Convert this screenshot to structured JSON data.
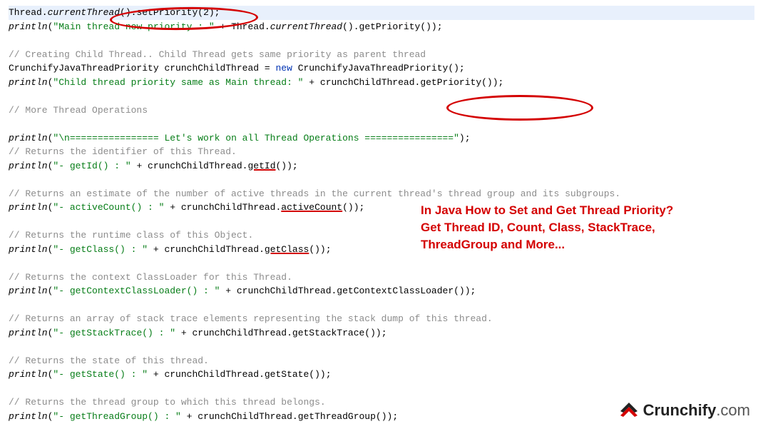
{
  "code": {
    "l1_a": "Thread.",
    "l1_b": "currentThread",
    "l1_c": "().setPriority(",
    "l1_d": "2",
    "l1_e": ");",
    "l2_a": "println",
    "l2_b": "(",
    "l2_c": "\"Main thread new priority : \"",
    "l2_d": " + Thread.",
    "l2_e": "currentThread",
    "l2_f": "().getPriority());",
    "l3": "",
    "l4": "// Creating Child Thread.. Child Thread gets same priority as parent thread",
    "l5_a": "CrunchifyJavaThreadPriority ",
    "l5_b": "crunchChildThread",
    "l5_c": " = ",
    "l5_d": "new ",
    "l5_e": "CrunchifyJavaThreadPriority();",
    "l6_a": "println",
    "l6_b": "(",
    "l6_c": "\"Child thread priority same as Main thread: \"",
    "l6_d": " + ",
    "l6_e": "crunchChildThread",
    "l6_f": ".getPriority());",
    "l7": "",
    "l8": "// More Thread Operations",
    "l9": "",
    "l10_a": "println",
    "l10_b": "(",
    "l10_c": "\"\\n================ Let's work on all Thread Operations ================\"",
    "l10_d": ");",
    "l11": "// Returns the identifier of this Thread.",
    "l12_a": "println",
    "l12_b": "(",
    "l12_c": "\"- getId() : \"",
    "l12_d": " + ",
    "l12_e": "crunchChildThread",
    "l12_f": ".",
    "l12_g": "getId",
    "l12_h": "());",
    "l13": "",
    "l14": "// Returns an estimate of the number of active threads in the current thread's thread group and its subgroups.",
    "l15_a": "println",
    "l15_b": "(",
    "l15_c": "\"- activeCount() : \"",
    "l15_d": " + ",
    "l15_e": "crunchChildThread",
    "l15_f": ".",
    "l15_g": "activeCount",
    "l15_h": "());",
    "l16": "",
    "l17": "// Returns the runtime class of this Object.",
    "l18_a": "println",
    "l18_b": "(",
    "l18_c": "\"- getClass() : \"",
    "l18_d": " + ",
    "l18_e": "crunchChildThread",
    "l18_f": ".",
    "l18_g": "getClass",
    "l18_h": "());",
    "l19": "",
    "l20": "// Returns the context ClassLoader for this Thread.",
    "l21_a": "println",
    "l21_b": "(",
    "l21_c": "\"- getContextClassLoader() : \"",
    "l21_d": " + ",
    "l21_e": "crunchChildThread",
    "l21_f": ".getContextClassLoader());",
    "l22": "",
    "l23": "// Returns an array of stack trace elements representing the stack dump of this thread.",
    "l24_a": "println",
    "l24_b": "(",
    "l24_c": "\"- getStackTrace() : \"",
    "l24_d": " + ",
    "l24_e": "crunchChildThread",
    "l24_f": ".getStackTrace());",
    "l25": "",
    "l26": "// Returns the state of this thread.",
    "l27_a": "println",
    "l27_b": "(",
    "l27_c": "\"- getState() : \"",
    "l27_d": " + ",
    "l27_e": "crunchChildThread",
    "l27_f": ".getState());",
    "l28": "",
    "l29": "// Returns the thread group to which this thread belongs.",
    "l30_a": "println",
    "l30_b": "(",
    "l30_c": "\"- getThreadGroup() : \"",
    "l30_d": " + ",
    "l30_e": "crunchChildThread",
    "l30_f": ".getThreadGroup());"
  },
  "caption": {
    "l1": "In Java How to Set and Get Thread Priority?",
    "l2": "Get Thread ID, Count, Class, StackTrace,",
    "l3": "ThreadGroup and More..."
  },
  "logo": {
    "brand": "Crunchify",
    "tld": ".com"
  }
}
